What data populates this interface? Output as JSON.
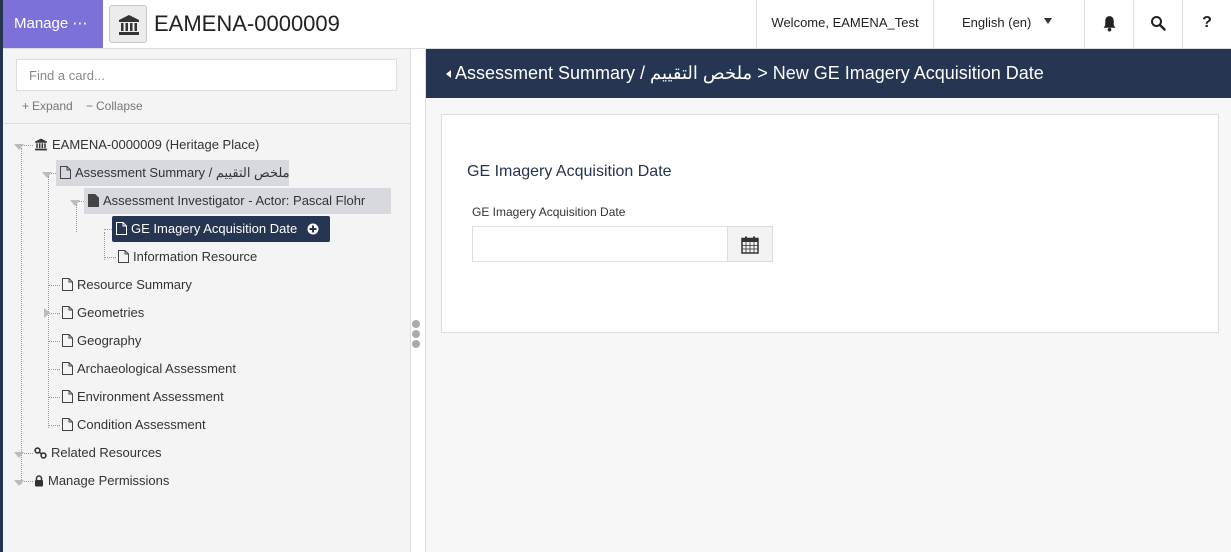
{
  "header": {
    "manage_label": "Manage ⋯",
    "resource_title": "EAMENA-0000009",
    "welcome": "Welcome, EAMENA_Test",
    "language": "English (en)",
    "help_label": "?",
    "icons": [
      "landmark-icon",
      "bell-icon",
      "search-icon",
      "help-icon"
    ]
  },
  "sidebar": {
    "search_placeholder": "Find a card...",
    "expand_label": "Expand",
    "collapse_label": "Collapse",
    "tree": {
      "root": "EAMENA-0000009 (Heritage Place)",
      "assessment_summary": "Assessment Summary / ملخص التقييم",
      "assessment_investigator": "Assessment Investigator - Actor: Pascal Flohr",
      "ge_imagery": "GE Imagery Acquisition Date",
      "information_resource": "Information Resource",
      "resource_summary": "Resource Summary",
      "geometries": "Geometries",
      "geography": "Geography",
      "archaeological_assessment": "Archaeological Assessment",
      "environment_assessment": "Environment Assessment",
      "condition_assessment": "Condition Assessment",
      "related_resources": "Related Resources",
      "manage_permissions": "Manage Permissions"
    }
  },
  "main": {
    "breadcrumb": "Assessment Summary / ملخص التقييم > New GE Imagery Acquisition Date",
    "form_title": "GE Imagery Acquisition Date",
    "field_label": "GE Imagery Acquisition Date",
    "field_value": ""
  },
  "colors": {
    "manage_purple": "#7b71d8",
    "navy": "#253552",
    "highlight": "#d7d9de"
  }
}
